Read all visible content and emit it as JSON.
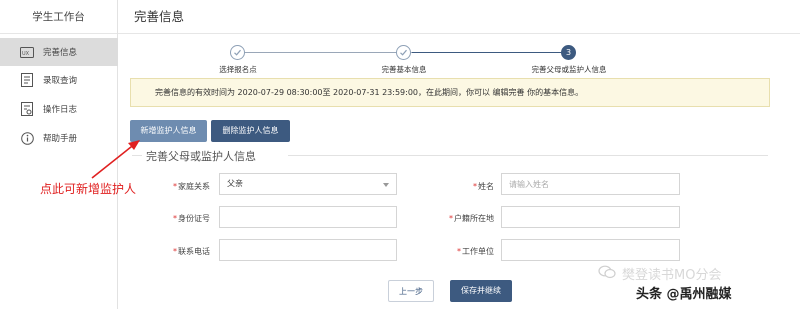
{
  "sidebar": {
    "title": "学生工作台",
    "items": [
      {
        "label": "完善信息",
        "icon": "id-card-icon",
        "active": true
      },
      {
        "label": "录取查询",
        "icon": "document-icon",
        "active": false
      },
      {
        "label": "操作日志",
        "icon": "log-icon",
        "active": false
      },
      {
        "label": "帮助手册",
        "icon": "info-icon",
        "active": false
      }
    ]
  },
  "header": {
    "title": "完善信息"
  },
  "stepper": {
    "steps": [
      {
        "label": "选择报名点",
        "state": "done",
        "marker": ""
      },
      {
        "label": "完善基本信息",
        "state": "done",
        "marker": ""
      },
      {
        "label": "完善父母或监护人信息",
        "state": "current",
        "marker": "3"
      }
    ]
  },
  "notice": {
    "text": "完善信息的有效时间为 2020-07-29 08:30:00至 2020-07-31 23:59:00，在此期间，你可以 编辑完善 你的基本信息。"
  },
  "toolbar": {
    "add_label": "新增监护人信息",
    "delete_label": "删除监护人信息"
  },
  "annotation": {
    "text": "点此可新增监护人",
    "color": "#e02020"
  },
  "section": {
    "title": "完善父母或监护人信息"
  },
  "form": {
    "relation": {
      "label": "家庭关系",
      "value": "父亲"
    },
    "name": {
      "label": "姓名",
      "placeholder": "请输入姓名"
    },
    "id_number": {
      "label": "身份证号",
      "value": ""
    },
    "hukou": {
      "label": "户籍所在地",
      "value": ""
    },
    "phone": {
      "label": "联系电话",
      "value": ""
    },
    "employer": {
      "label": "工作单位",
      "value": ""
    },
    "required_mark": "*"
  },
  "footer": {
    "prev_label": "上一步",
    "save_label": "保存并继续"
  },
  "watermark": {
    "line1": "樊登读书MO分会",
    "line2": "头条 @禹州融媒"
  },
  "colors": {
    "primary": "#3d5a80",
    "primary_light": "#6e8cb0",
    "notice_bg": "#fcf8e3",
    "required": "#d33333"
  }
}
